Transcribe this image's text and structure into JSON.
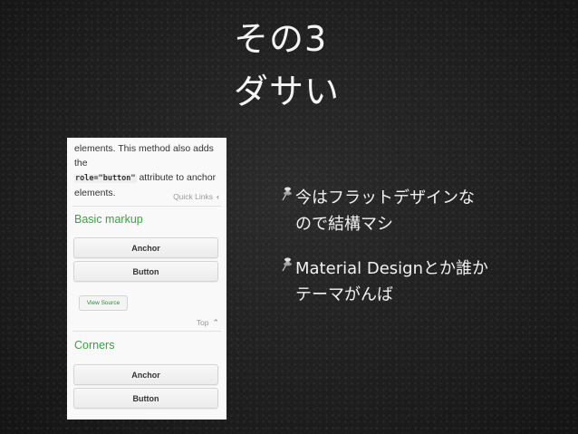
{
  "slide": {
    "title_line1": "その3",
    "title_line2": "ダサい"
  },
  "screenshot": {
    "intro_text_1": "elements. This method also adds the",
    "intro_code": "role=\"button\"",
    "intro_text_2": " attribute to anchor",
    "intro_text_3": "elements.",
    "quick_links": "Quick Links",
    "section1_heading": "Basic markup",
    "anchor_label": "Anchor",
    "button_label": "Button",
    "view_source": "View Source",
    "top_link": "Top",
    "section2_heading": "Corners",
    "anchor_label_2": "Anchor",
    "button_label_2": "Button",
    "accent_color": "#38a53f"
  },
  "bullets": [
    {
      "line1": "今はフラットデザインな",
      "line2": "ので結構マシ",
      "icon": "pushpin-icon"
    },
    {
      "line1": "Material Designとか誰か",
      "line2": "テーマがんば",
      "icon": "pushpin-icon"
    }
  ]
}
